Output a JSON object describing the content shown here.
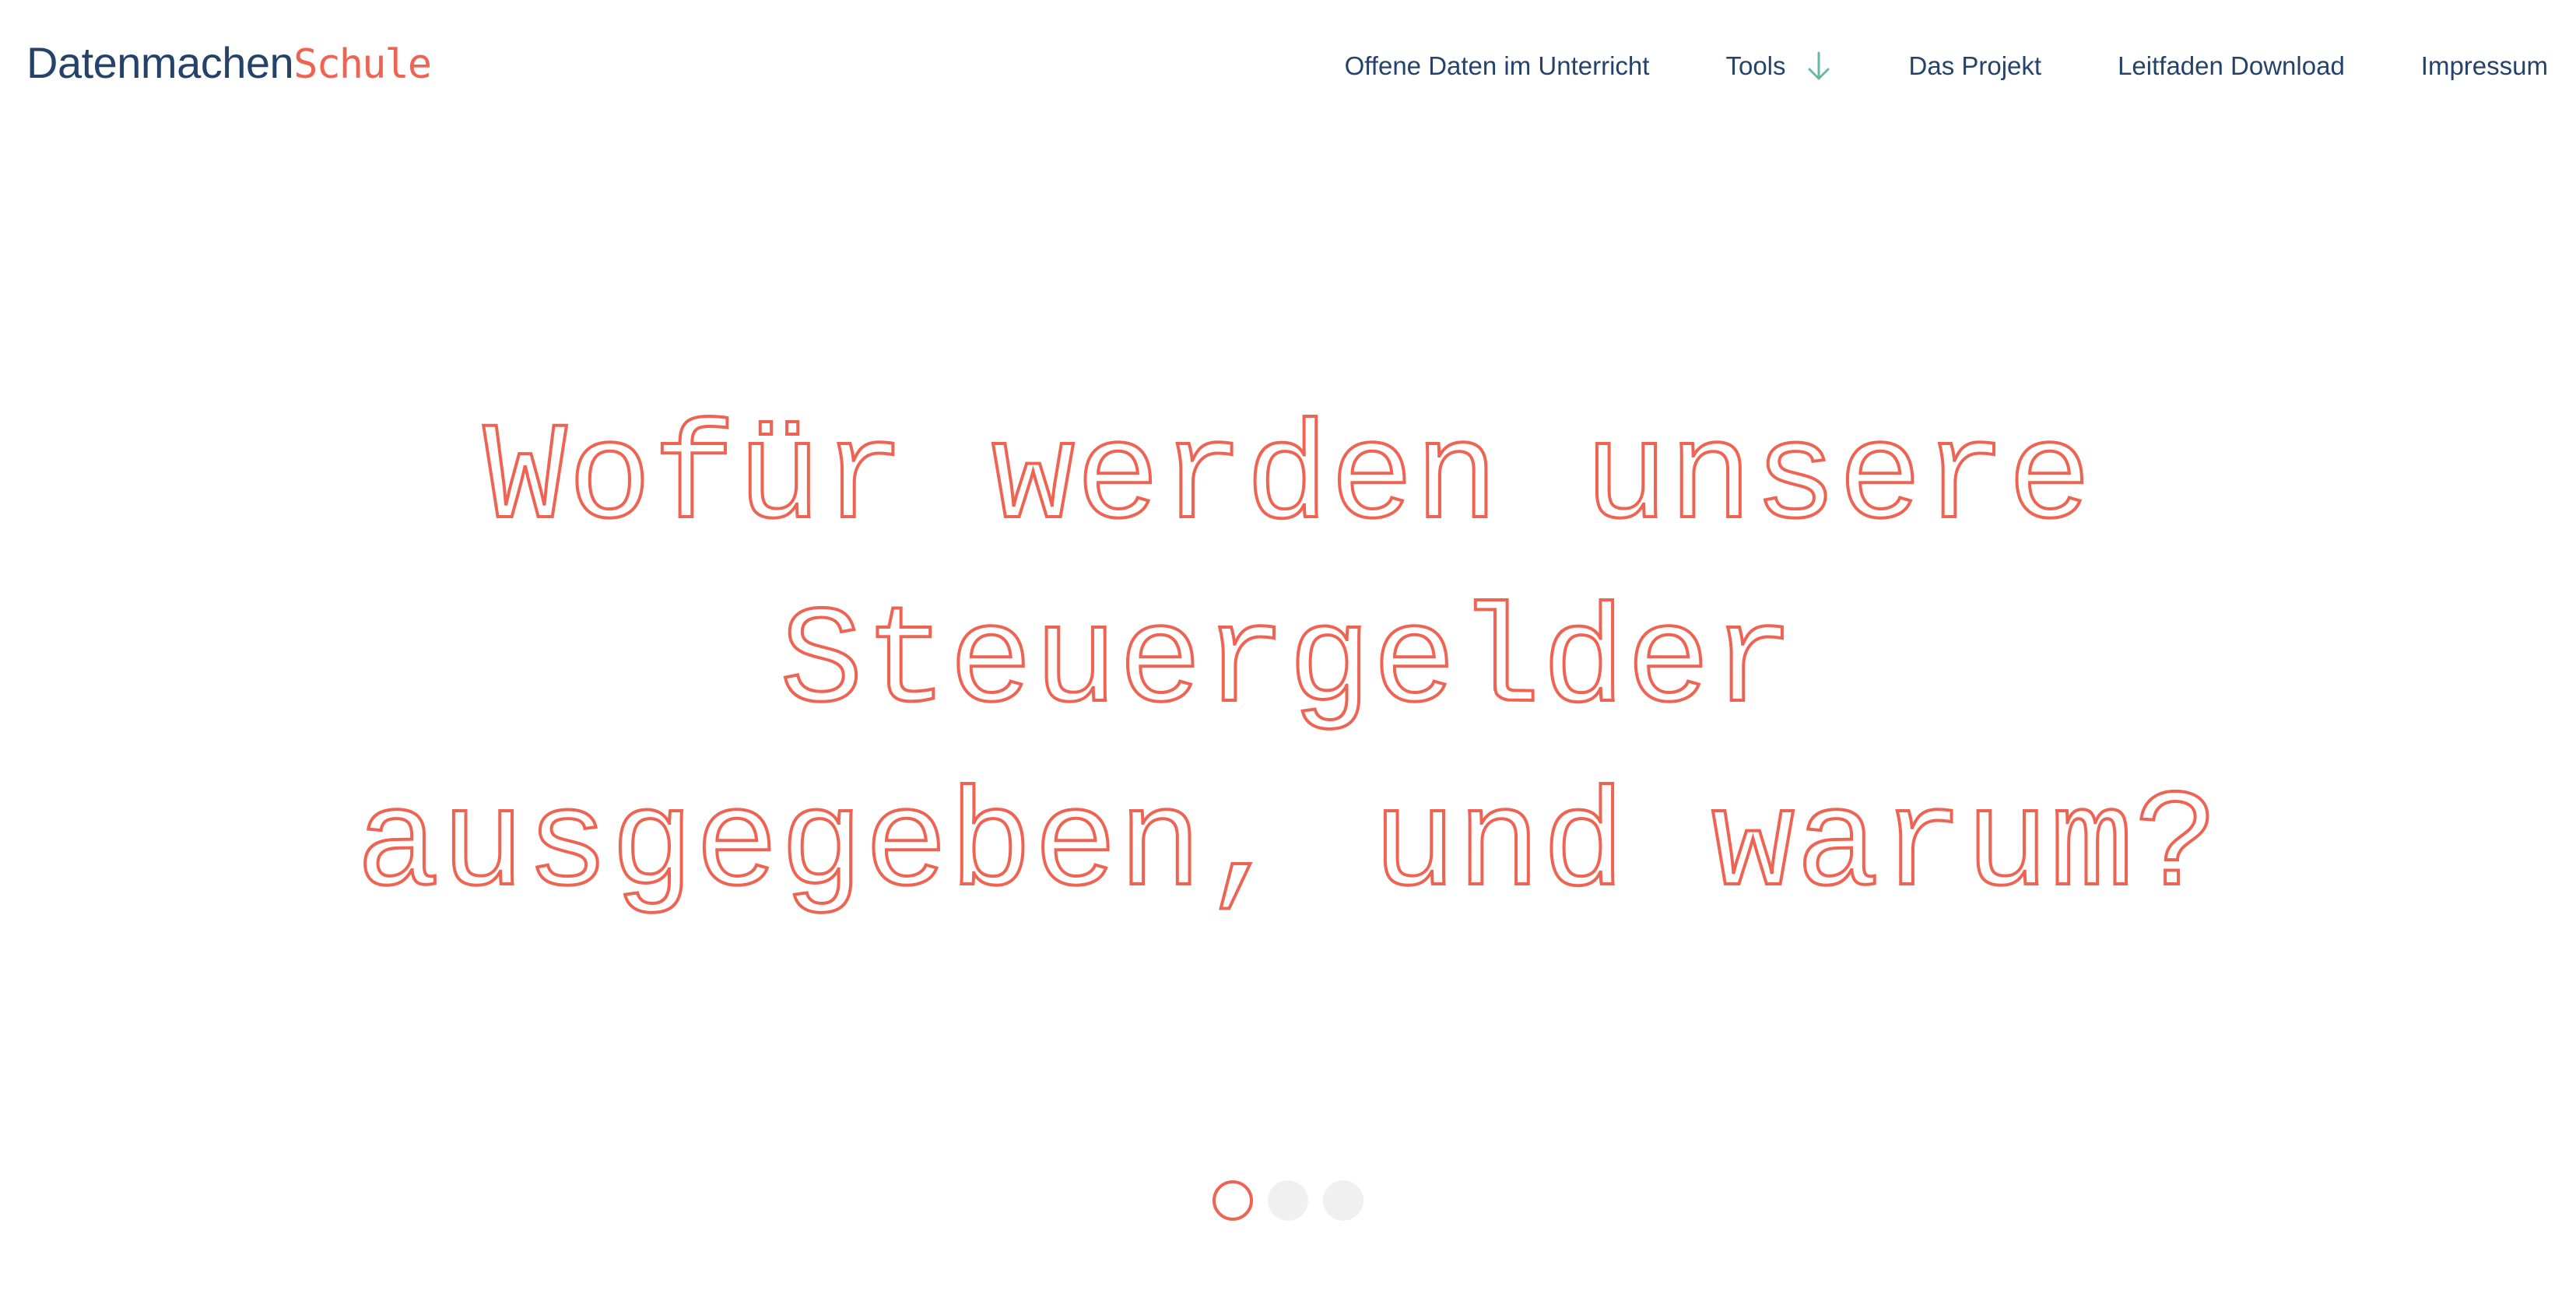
{
  "header": {
    "logo": {
      "main": "Datenmachen",
      "accent": "Schule"
    },
    "nav": [
      {
        "label": "Offene Daten im Unterricht"
      },
      {
        "label": "Tools",
        "icon": "arrow-down-icon"
      },
      {
        "label": "Das Projekt"
      },
      {
        "label": "Leitfaden Download"
      },
      {
        "label": "Impressum"
      }
    ]
  },
  "hero": {
    "title": "Wofür werden unsere Steuergelder ausgegeben, und warum?"
  },
  "carousel": {
    "slide_count": 3,
    "active_index": 0
  },
  "colors": {
    "brand_navy": "#24426a",
    "accent_coral": "#ee6352",
    "tools_arrow": "#6ab8a4",
    "dot_inactive": "#f0f0f0",
    "background": "#ffffff"
  }
}
